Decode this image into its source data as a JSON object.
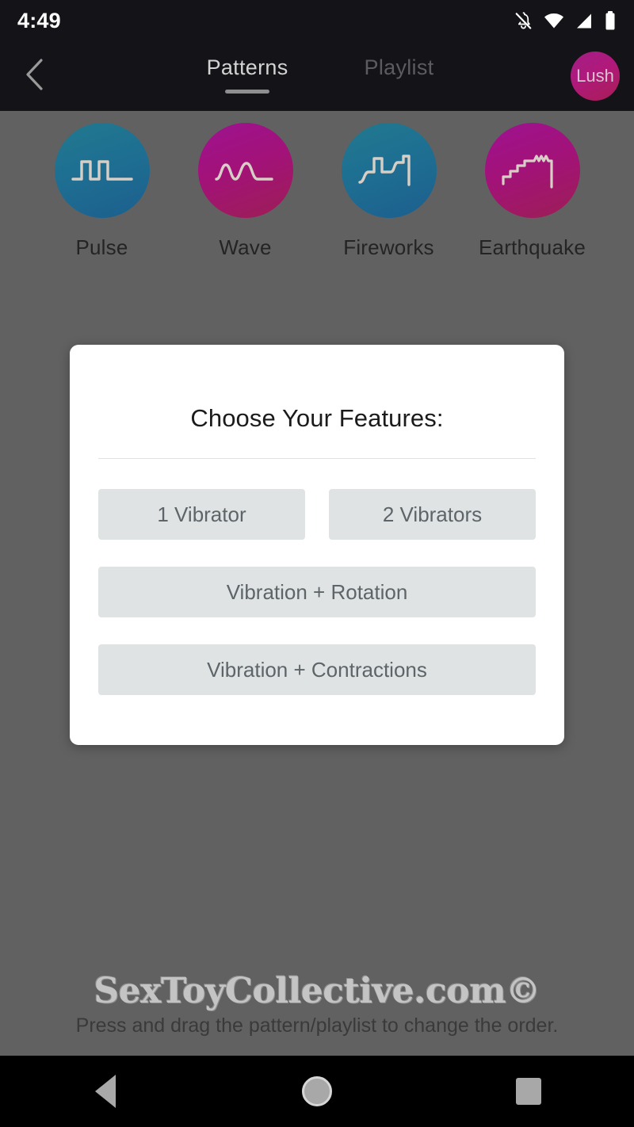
{
  "status_bar": {
    "time": "4:49",
    "icons": [
      "bell-muted-icon",
      "wifi-icon",
      "cellular-signal-icon",
      "battery-icon"
    ]
  },
  "app_bar": {
    "back_icon": "chevron-left-icon",
    "tabs": [
      {
        "label": "Patterns",
        "active": true
      },
      {
        "label": "Playlist",
        "active": false
      }
    ],
    "avatar_label": "Lush"
  },
  "patterns": [
    {
      "label": "Pulse",
      "icon": "square-wave-icon",
      "color": "teal"
    },
    {
      "label": "Wave",
      "icon": "sine-wave-icon",
      "color": "pink"
    },
    {
      "label": "Fireworks",
      "icon": "step-wave-icon",
      "color": "teal"
    },
    {
      "label": "Earthquake",
      "icon": "staircase-wave-icon",
      "color": "pink"
    }
  ],
  "dialog": {
    "title": "Choose Your Features:",
    "options_row": [
      {
        "label": "1 Vibrator"
      },
      {
        "label": "2 Vibrators"
      }
    ],
    "options_full": [
      {
        "label": "Vibration + Rotation"
      },
      {
        "label": "Vibration + Contractions"
      }
    ]
  },
  "watermark": "SexToyCollective.com©",
  "hint": "Press and drag the pattern/playlist to change the order.",
  "nav_bar": {
    "back": "nav-back-icon",
    "home": "nav-home-icon",
    "recents": "nav-recents-icon"
  },
  "colors": {
    "status_bg": "#141418",
    "scrim": "#616161",
    "teal_circle": "#1e6f92",
    "pink_circle": "#a31279",
    "dialog_bg": "#ffffff",
    "option_bg": "#dfe3e4",
    "option_text": "#5d6568",
    "nav_bg": "#000000"
  }
}
